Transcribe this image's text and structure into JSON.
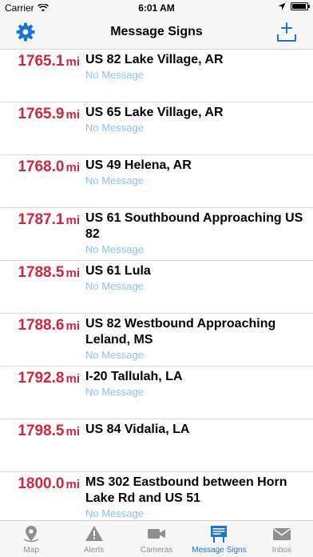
{
  "status_bar": {
    "carrier": "Carrier",
    "time": "6:01 AM"
  },
  "nav": {
    "title": "Message Signs"
  },
  "rows": [
    {
      "mile": "1765.1",
      "unit": "mi",
      "name": "US 82 Lake Village, AR",
      "message": "No Message"
    },
    {
      "mile": "1765.9",
      "unit": "mi",
      "name": "US 65 Lake Village, AR",
      "message": "No Message"
    },
    {
      "mile": "1768.0",
      "unit": "mi",
      "name": "US 49 Helena, AR",
      "message": "No Message"
    },
    {
      "mile": "1787.1",
      "unit": "mi",
      "name": "US 61 Southbound Approaching US 82",
      "message": "No Message"
    },
    {
      "mile": "1788.5",
      "unit": "mi",
      "name": "US 61 Lula",
      "message": "No Message"
    },
    {
      "mile": "1788.6",
      "unit": "mi",
      "name": "US 82 Westbound Approaching Leland, MS",
      "message": "No Message"
    },
    {
      "mile": "1792.8",
      "unit": "mi",
      "name": "I-20 Tallulah, LA",
      "message": "No Message"
    },
    {
      "mile": "1798.5",
      "unit": "mi",
      "name": "US 84 Vidalia, LA",
      "message": ""
    },
    {
      "mile": "1800.0",
      "unit": "mi",
      "name": "MS 302 Eastbound between Horn Lake Rd and US 51",
      "message": "No Message"
    }
  ],
  "tabs": [
    {
      "label": "Map",
      "icon": "map-pin-icon"
    },
    {
      "label": "Alerts",
      "icon": "warning-icon"
    },
    {
      "label": "Cameras",
      "icon": "video-camera-icon"
    },
    {
      "label": "Message Signs",
      "icon": "message-sign-icon",
      "active": true
    },
    {
      "label": "Inbox",
      "icon": "envelope-icon"
    }
  ],
  "colors": {
    "accent": "#1a73d8",
    "mile": "#d0263e",
    "message": "#8fc3ee"
  }
}
